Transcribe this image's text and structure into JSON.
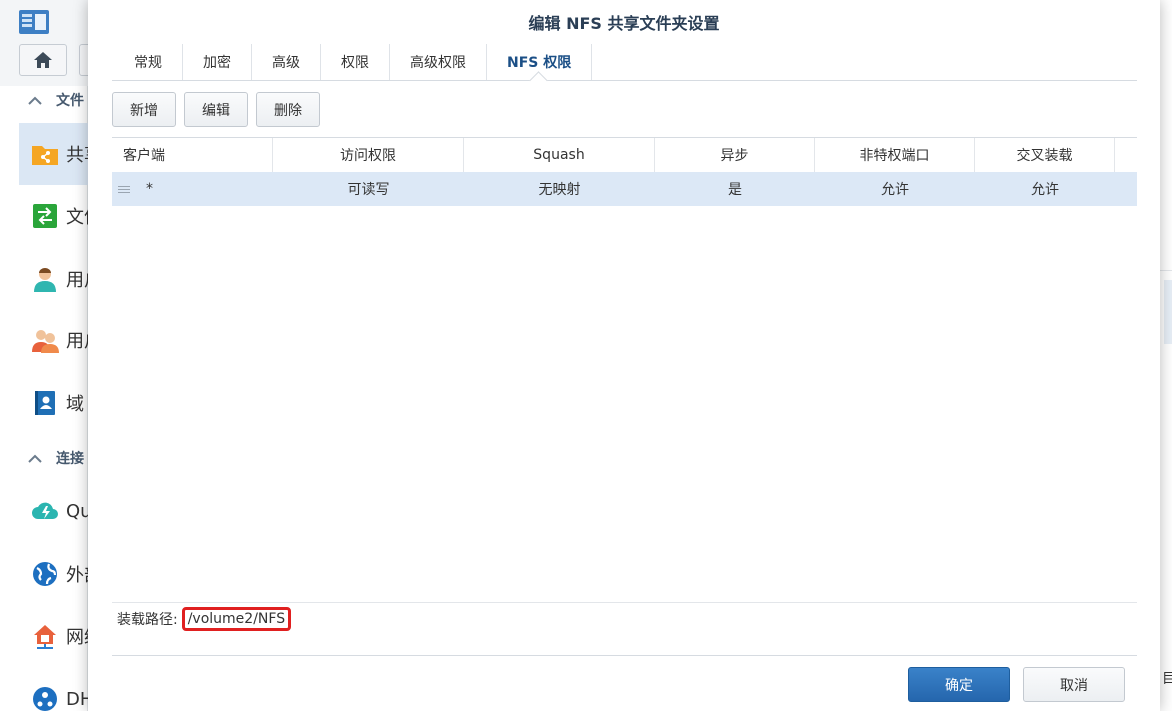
{
  "background": {
    "sections": [
      {
        "label": "文件"
      },
      {
        "label": "连接"
      }
    ],
    "items": [
      {
        "label": "共享",
        "icon": "shared-folder-icon"
      },
      {
        "label": "文件",
        "icon": "file-services-icon"
      },
      {
        "label": "用户",
        "icon": "user-icon"
      },
      {
        "label": "用户",
        "icon": "group-icon"
      },
      {
        "label": "域",
        "icon": "domain-icon"
      },
      {
        "label": "Qu",
        "icon": "quickconnect-icon"
      },
      {
        "label": "外部",
        "icon": "external-access-icon"
      },
      {
        "label": "网络",
        "icon": "network-icon"
      },
      {
        "label": "DH",
        "icon": "dhcp-icon"
      }
    ],
    "right_edge_text": "目"
  },
  "dialog": {
    "title": "编辑 NFS 共享文件夹设置",
    "tabs": [
      {
        "label": "常规"
      },
      {
        "label": "加密"
      },
      {
        "label": "高级"
      },
      {
        "label": "权限"
      },
      {
        "label": "高级权限"
      },
      {
        "label": "NFS 权限"
      }
    ],
    "active_tab": "NFS 权限",
    "toolbar": {
      "add_label": "新增",
      "edit_label": "编辑",
      "delete_label": "删除"
    },
    "table": {
      "columns": [
        "客户端",
        "访问权限",
        "Squash",
        "异步",
        "非特权端口",
        "交叉装载"
      ],
      "rows": [
        {
          "client": "*",
          "access": "可读写",
          "squash": "无映射",
          "async": "是",
          "non_privileged_port": "允许",
          "cross_mount": "允许"
        }
      ]
    },
    "mount_path_label": "装载路径:",
    "mount_path": "/volume2/NFS",
    "ok_label": "确定",
    "cancel_label": "取消"
  },
  "colors": {
    "accent": "#2566ad",
    "selected_row": "#dce8f6",
    "highlight_box": "#e02020",
    "title": "#2a3e55"
  }
}
